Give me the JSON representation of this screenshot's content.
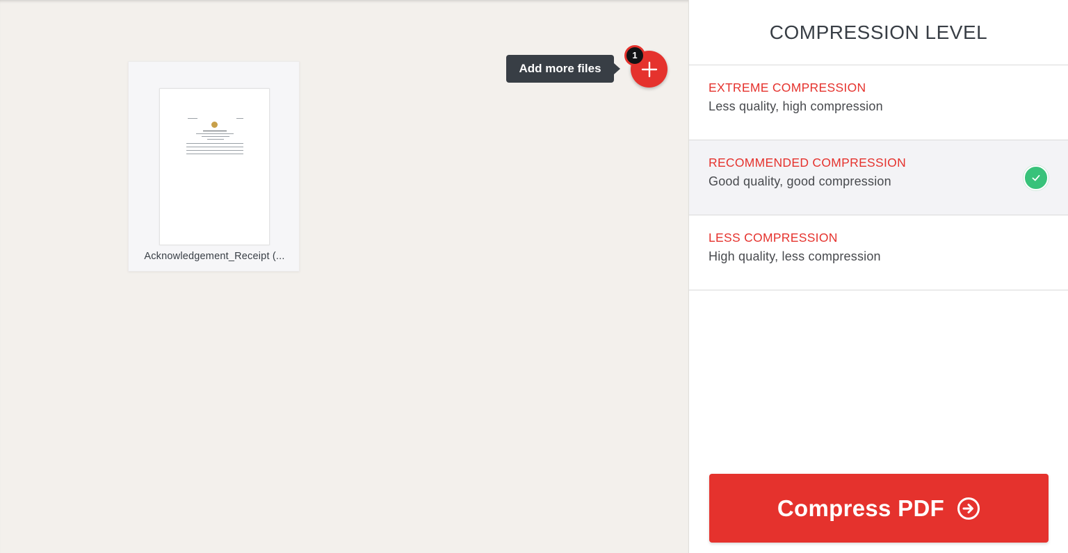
{
  "workspace": {
    "files": [
      {
        "name": "Acknowledgement_Receipt (..."
      }
    ],
    "add_files": {
      "tooltip": "Add more files",
      "count_badge": "1",
      "icon": "plus-icon"
    }
  },
  "sidebar": {
    "title": "COMPRESSION LEVEL",
    "options": [
      {
        "title": "EXTREME COMPRESSION",
        "description": "Less quality, high compression",
        "selected": false
      },
      {
        "title": "RECOMMENDED COMPRESSION",
        "description": "Good quality, good compression",
        "selected": true,
        "icon": "check-icon"
      },
      {
        "title": "LESS COMPRESSION",
        "description": "High quality, less compression",
        "selected": false
      }
    ],
    "action_button": {
      "label": "Compress PDF",
      "icon": "arrow-right-circle-icon"
    }
  },
  "colors": {
    "accent": "#e5322d",
    "success": "#38c27a",
    "text": "#383e45",
    "workspace_bg": "#f3f0ec"
  }
}
